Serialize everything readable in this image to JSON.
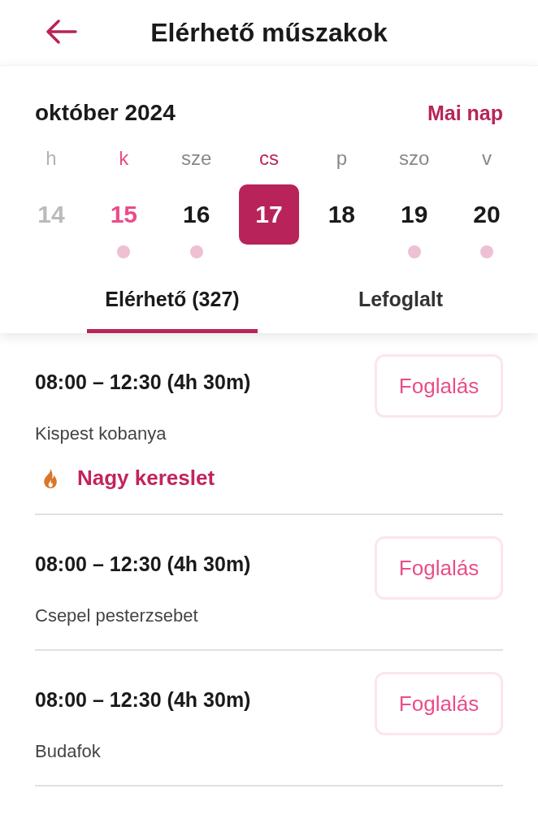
{
  "header": {
    "title": "Elérhető műszakok"
  },
  "calendar": {
    "month": "október 2024",
    "today_button": "Mai nap",
    "days": [
      {
        "weekday": "h",
        "date": "14",
        "past": true,
        "today": false,
        "selected": false,
        "has_shifts": false
      },
      {
        "weekday": "k",
        "date": "15",
        "past": false,
        "today": true,
        "selected": false,
        "has_shifts": true
      },
      {
        "weekday": "sze",
        "date": "16",
        "past": false,
        "today": false,
        "selected": false,
        "has_shifts": true
      },
      {
        "weekday": "cs",
        "date": "17",
        "past": false,
        "today": false,
        "selected": true,
        "has_shifts": false
      },
      {
        "weekday": "p",
        "date": "18",
        "past": false,
        "today": false,
        "selected": false,
        "has_shifts": false
      },
      {
        "weekday": "szo",
        "date": "19",
        "past": false,
        "today": false,
        "selected": false,
        "has_shifts": true
      },
      {
        "weekday": "v",
        "date": "20",
        "past": false,
        "today": false,
        "selected": false,
        "has_shifts": true
      }
    ]
  },
  "tabs": [
    {
      "label": "Elérhető (327)",
      "selected": true
    },
    {
      "label": "Lefoglalt",
      "selected": false
    }
  ],
  "shifts": [
    {
      "time": "08:00 – 12:30 (4h 30m)",
      "location": "Kispest kobanya",
      "badge": "Nagy kereslet",
      "button": "Foglalás"
    },
    {
      "time": "08:00 – 12:30 (4h 30m)",
      "location": "Csepel pesterzsebet",
      "button": "Foglalás"
    },
    {
      "time": "08:00 – 12:30 (4h 30m)",
      "location": "Budafok",
      "button": "Foglalás"
    }
  ]
}
